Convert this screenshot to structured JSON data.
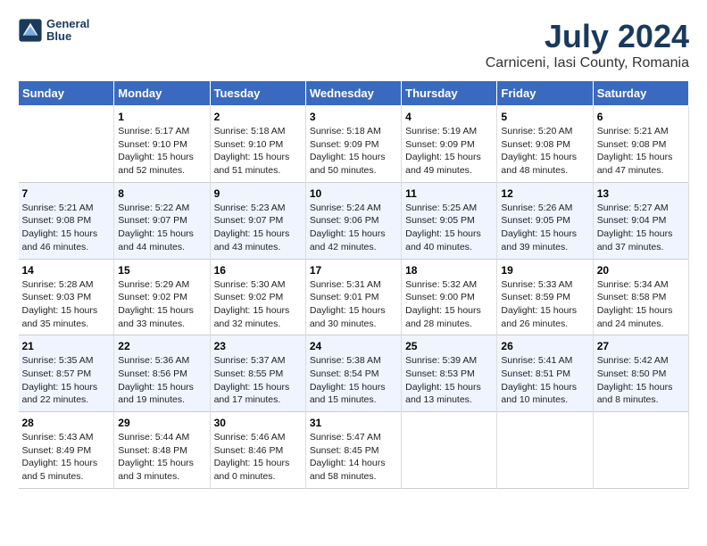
{
  "header": {
    "logo_line1": "General",
    "logo_line2": "Blue",
    "title": "July 2024",
    "subtitle": "Carniceni, Iasi County, Romania"
  },
  "calendar": {
    "days_of_week": [
      "Sunday",
      "Monday",
      "Tuesday",
      "Wednesday",
      "Thursday",
      "Friday",
      "Saturday"
    ],
    "weeks": [
      [
        {
          "day": "",
          "info": ""
        },
        {
          "day": "1",
          "info": "Sunrise: 5:17 AM\nSunset: 9:10 PM\nDaylight: 15 hours\nand 52 minutes."
        },
        {
          "day": "2",
          "info": "Sunrise: 5:18 AM\nSunset: 9:10 PM\nDaylight: 15 hours\nand 51 minutes."
        },
        {
          "day": "3",
          "info": "Sunrise: 5:18 AM\nSunset: 9:09 PM\nDaylight: 15 hours\nand 50 minutes."
        },
        {
          "day": "4",
          "info": "Sunrise: 5:19 AM\nSunset: 9:09 PM\nDaylight: 15 hours\nand 49 minutes."
        },
        {
          "day": "5",
          "info": "Sunrise: 5:20 AM\nSunset: 9:08 PM\nDaylight: 15 hours\nand 48 minutes."
        },
        {
          "day": "6",
          "info": "Sunrise: 5:21 AM\nSunset: 9:08 PM\nDaylight: 15 hours\nand 47 minutes."
        }
      ],
      [
        {
          "day": "7",
          "info": "Sunrise: 5:21 AM\nSunset: 9:08 PM\nDaylight: 15 hours\nand 46 minutes."
        },
        {
          "day": "8",
          "info": "Sunrise: 5:22 AM\nSunset: 9:07 PM\nDaylight: 15 hours\nand 44 minutes."
        },
        {
          "day": "9",
          "info": "Sunrise: 5:23 AM\nSunset: 9:07 PM\nDaylight: 15 hours\nand 43 minutes."
        },
        {
          "day": "10",
          "info": "Sunrise: 5:24 AM\nSunset: 9:06 PM\nDaylight: 15 hours\nand 42 minutes."
        },
        {
          "day": "11",
          "info": "Sunrise: 5:25 AM\nSunset: 9:05 PM\nDaylight: 15 hours\nand 40 minutes."
        },
        {
          "day": "12",
          "info": "Sunrise: 5:26 AM\nSunset: 9:05 PM\nDaylight: 15 hours\nand 39 minutes."
        },
        {
          "day": "13",
          "info": "Sunrise: 5:27 AM\nSunset: 9:04 PM\nDaylight: 15 hours\nand 37 minutes."
        }
      ],
      [
        {
          "day": "14",
          "info": "Sunrise: 5:28 AM\nSunset: 9:03 PM\nDaylight: 15 hours\nand 35 minutes."
        },
        {
          "day": "15",
          "info": "Sunrise: 5:29 AM\nSunset: 9:02 PM\nDaylight: 15 hours\nand 33 minutes."
        },
        {
          "day": "16",
          "info": "Sunrise: 5:30 AM\nSunset: 9:02 PM\nDaylight: 15 hours\nand 32 minutes."
        },
        {
          "day": "17",
          "info": "Sunrise: 5:31 AM\nSunset: 9:01 PM\nDaylight: 15 hours\nand 30 minutes."
        },
        {
          "day": "18",
          "info": "Sunrise: 5:32 AM\nSunset: 9:00 PM\nDaylight: 15 hours\nand 28 minutes."
        },
        {
          "day": "19",
          "info": "Sunrise: 5:33 AM\nSunset: 8:59 PM\nDaylight: 15 hours\nand 26 minutes."
        },
        {
          "day": "20",
          "info": "Sunrise: 5:34 AM\nSunset: 8:58 PM\nDaylight: 15 hours\nand 24 minutes."
        }
      ],
      [
        {
          "day": "21",
          "info": "Sunrise: 5:35 AM\nSunset: 8:57 PM\nDaylight: 15 hours\nand 22 minutes."
        },
        {
          "day": "22",
          "info": "Sunrise: 5:36 AM\nSunset: 8:56 PM\nDaylight: 15 hours\nand 19 minutes."
        },
        {
          "day": "23",
          "info": "Sunrise: 5:37 AM\nSunset: 8:55 PM\nDaylight: 15 hours\nand 17 minutes."
        },
        {
          "day": "24",
          "info": "Sunrise: 5:38 AM\nSunset: 8:54 PM\nDaylight: 15 hours\nand 15 minutes."
        },
        {
          "day": "25",
          "info": "Sunrise: 5:39 AM\nSunset: 8:53 PM\nDaylight: 15 hours\nand 13 minutes."
        },
        {
          "day": "26",
          "info": "Sunrise: 5:41 AM\nSunset: 8:51 PM\nDaylight: 15 hours\nand 10 minutes."
        },
        {
          "day": "27",
          "info": "Sunrise: 5:42 AM\nSunset: 8:50 PM\nDaylight: 15 hours\nand 8 minutes."
        }
      ],
      [
        {
          "day": "28",
          "info": "Sunrise: 5:43 AM\nSunset: 8:49 PM\nDaylight: 15 hours\nand 5 minutes."
        },
        {
          "day": "29",
          "info": "Sunrise: 5:44 AM\nSunset: 8:48 PM\nDaylight: 15 hours\nand 3 minutes."
        },
        {
          "day": "30",
          "info": "Sunrise: 5:46 AM\nSunset: 8:46 PM\nDaylight: 15 hours\nand 0 minutes."
        },
        {
          "day": "31",
          "info": "Sunrise: 5:47 AM\nSunset: 8:45 PM\nDaylight: 14 hours\nand 58 minutes."
        },
        {
          "day": "",
          "info": ""
        },
        {
          "day": "",
          "info": ""
        },
        {
          "day": "",
          "info": ""
        }
      ]
    ]
  }
}
